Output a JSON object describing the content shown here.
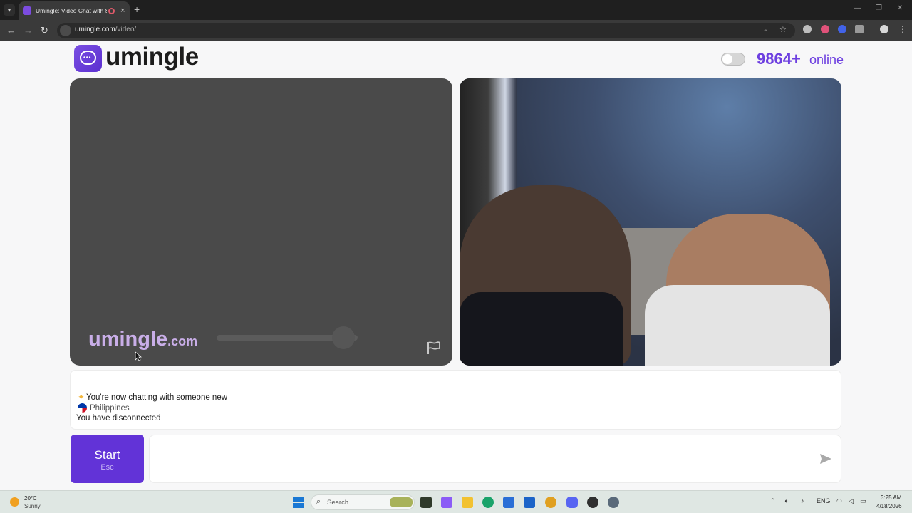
{
  "browser": {
    "tab_title": "Umingle: Video Chat with S",
    "url_host": "umingle.com",
    "url_path": "/video/",
    "new_tab_symbol": "+",
    "tab_close_symbol": "×"
  },
  "header": {
    "brand": "umingle",
    "online_count": "9864+",
    "online_label": "online",
    "toggle_on": false
  },
  "local_video": {
    "watermark_name": "umingle",
    "watermark_tld": ".com",
    "volume_level": 0.9
  },
  "chat": {
    "messages": [
      "You're now chatting with someone new",
      "Philippines",
      "You have disconnected"
    ]
  },
  "controls": {
    "start_label": "Start",
    "start_hint": "Esc",
    "message_placeholder": ""
  },
  "taskbar": {
    "temperature": "20°C",
    "condition": "Sunny",
    "search_label": "Search",
    "language": "ENG",
    "time": "3:25 AM",
    "date": "4/18/2026"
  },
  "colors": {
    "accent": "#6233d7",
    "brand_purple": "#6d3fe0",
    "video_bg": "#4a4a4a"
  },
  "icons": {
    "back": "arrow-left-icon",
    "forward": "arrow-right-icon",
    "reload": "reload-icon",
    "zoom": "magnifier-icon",
    "bookmark": "star-icon",
    "report": "flag-icon",
    "send": "paper-plane-icon",
    "windows": "windows-logo-icon"
  }
}
